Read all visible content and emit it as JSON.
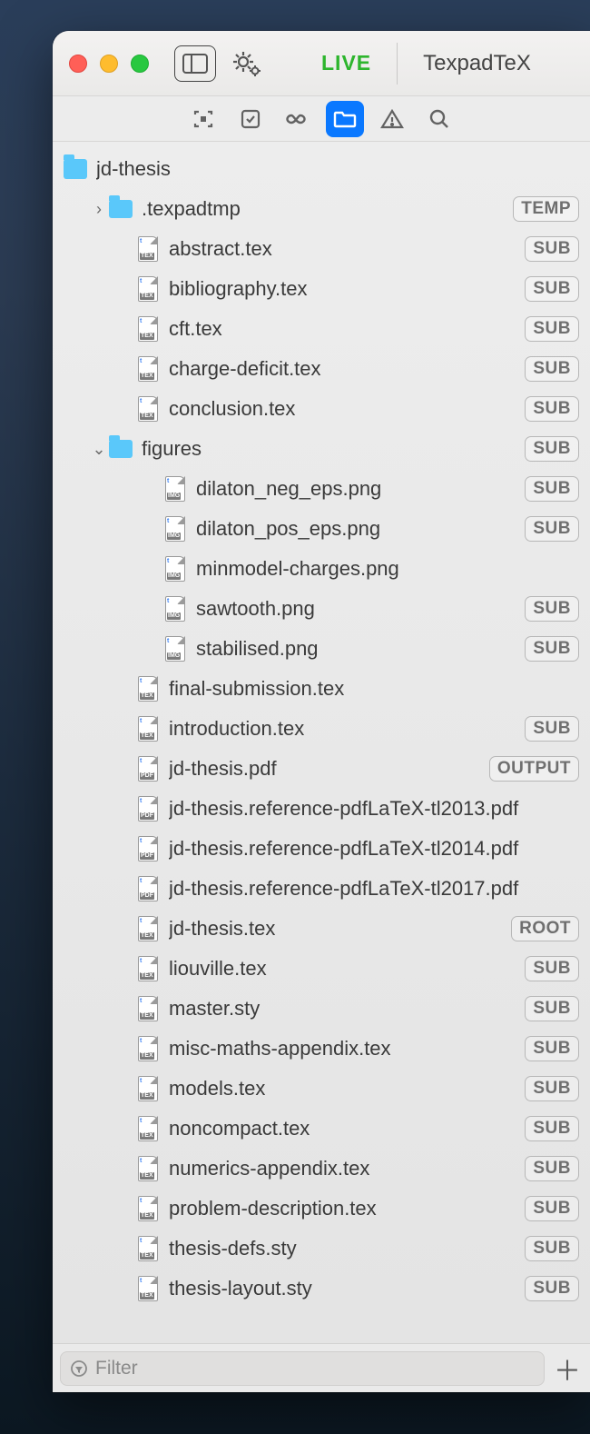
{
  "titlebar": {
    "live_label": "LIVE",
    "tab_title": "TexpadTeX"
  },
  "toolbar_selected": 3,
  "project": {
    "name": "jd-thesis",
    "items": [
      {
        "type": "folder",
        "name": ".texpadtmp",
        "indent": 1,
        "expanded": false,
        "badge": "TEMP"
      },
      {
        "type": "tex",
        "name": "abstract.tex",
        "indent": 2,
        "badge": "SUB"
      },
      {
        "type": "tex",
        "name": "bibliography.tex",
        "indent": 2,
        "badge": "SUB"
      },
      {
        "type": "tex",
        "name": "cft.tex",
        "indent": 2,
        "badge": "SUB"
      },
      {
        "type": "tex",
        "name": "charge-deficit.tex",
        "indent": 2,
        "badge": "SUB"
      },
      {
        "type": "tex",
        "name": "conclusion.tex",
        "indent": 2,
        "badge": "SUB"
      },
      {
        "type": "folder",
        "name": "figures",
        "indent": 1,
        "expanded": true,
        "badge": "SUB"
      },
      {
        "type": "img",
        "name": "dilaton_neg_eps.png",
        "indent": 3,
        "badge": "SUB"
      },
      {
        "type": "img",
        "name": "dilaton_pos_eps.png",
        "indent": 3,
        "badge": "SUB"
      },
      {
        "type": "img",
        "name": "minmodel-charges.png",
        "indent": 3,
        "badge": ""
      },
      {
        "type": "img",
        "name": "sawtooth.png",
        "indent": 3,
        "badge": "SUB"
      },
      {
        "type": "img",
        "name": "stabilised.png",
        "indent": 3,
        "badge": "SUB"
      },
      {
        "type": "tex",
        "name": "final-submission.tex",
        "indent": 2,
        "badge": ""
      },
      {
        "type": "tex",
        "name": "introduction.tex",
        "indent": 2,
        "badge": "SUB"
      },
      {
        "type": "pdf",
        "name": "jd-thesis.pdf",
        "indent": 2,
        "badge": "OUTPUT"
      },
      {
        "type": "pdf",
        "name": "jd-thesis.reference-pdfLaTeX-tl2013.pdf",
        "indent": 2,
        "badge": ""
      },
      {
        "type": "pdf",
        "name": "jd-thesis.reference-pdfLaTeX-tl2014.pdf",
        "indent": 2,
        "badge": ""
      },
      {
        "type": "pdf",
        "name": "jd-thesis.reference-pdfLaTeX-tl2017.pdf",
        "indent": 2,
        "badge": ""
      },
      {
        "type": "tex",
        "name": "jd-thesis.tex",
        "indent": 2,
        "badge": "ROOT"
      },
      {
        "type": "tex",
        "name": "liouville.tex",
        "indent": 2,
        "badge": "SUB"
      },
      {
        "type": "tex",
        "name": "master.sty",
        "indent": 2,
        "badge": "SUB"
      },
      {
        "type": "tex",
        "name": "misc-maths-appendix.tex",
        "indent": 2,
        "badge": "SUB"
      },
      {
        "type": "tex",
        "name": "models.tex",
        "indent": 2,
        "badge": "SUB"
      },
      {
        "type": "tex",
        "name": "noncompact.tex",
        "indent": 2,
        "badge": "SUB"
      },
      {
        "type": "tex",
        "name": "numerics-appendix.tex",
        "indent": 2,
        "badge": "SUB"
      },
      {
        "type": "tex",
        "name": "problem-description.tex",
        "indent": 2,
        "badge": "SUB"
      },
      {
        "type": "tex",
        "name": "thesis-defs.sty",
        "indent": 2,
        "badge": "SUB"
      },
      {
        "type": "tex",
        "name": "thesis-layout.sty",
        "indent": 2,
        "badge": "SUB"
      }
    ]
  },
  "footer": {
    "filter_placeholder": "Filter"
  },
  "file_type_labels": {
    "tex": "TEX",
    "img": "IMG",
    "pdf": "PDF"
  }
}
